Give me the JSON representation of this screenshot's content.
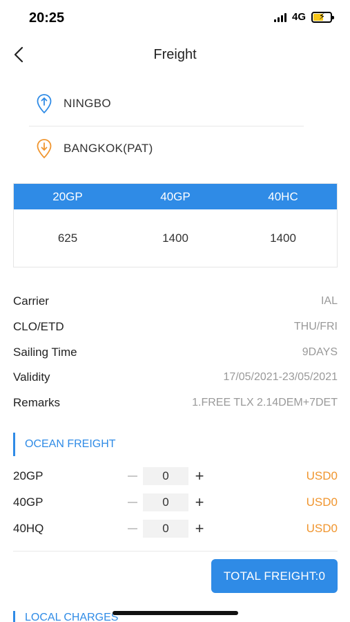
{
  "status_bar": {
    "time": "20:25",
    "network": "4G",
    "icons": [
      "signal-icon",
      "battery-charging-icon"
    ]
  },
  "nav": {
    "title": "Freight",
    "back_icon": "chevron-left-icon"
  },
  "route": {
    "origin": "NINGBO",
    "destination": "BANGKOK(PAT)",
    "origin_icon": "origin-pin-icon",
    "destination_icon": "destination-pin-icon",
    "colors": {
      "origin": "#2f8be6",
      "destination": "#f0952e"
    }
  },
  "price_table": {
    "headers": [
      "20GP",
      "40GP",
      "40HC"
    ],
    "values": [
      "625",
      "1400",
      "1400"
    ]
  },
  "details": [
    {
      "label": "Carrier",
      "value": "IAL"
    },
    {
      "label": "CLO/ETD",
      "value": "THU/FRI"
    },
    {
      "label": "Sailing Time",
      "value": "9DAYS"
    },
    {
      "label": "Validity",
      "value": "17/05/2021-23/05/2021"
    },
    {
      "label": "Remarks",
      "value": "1.FREE TLX 2.14DEM+7DET"
    }
  ],
  "ocean_freight": {
    "title": "OCEAN FREIGHT",
    "rows": [
      {
        "label": "20GP",
        "qty": "0",
        "amount": "USD0"
      },
      {
        "label": "40GP",
        "qty": "0",
        "amount": "USD0"
      },
      {
        "label": "40HQ",
        "qty": "0",
        "amount": "USD0"
      }
    ],
    "minus_icon": "minus-icon",
    "plus_symbol": "+"
  },
  "total_button": "TOTAL FREIGHT:0",
  "local_charges": {
    "title": "LOCAL CHARGES"
  },
  "colors": {
    "accent": "#2f8be6",
    "amount": "#f0952e"
  }
}
